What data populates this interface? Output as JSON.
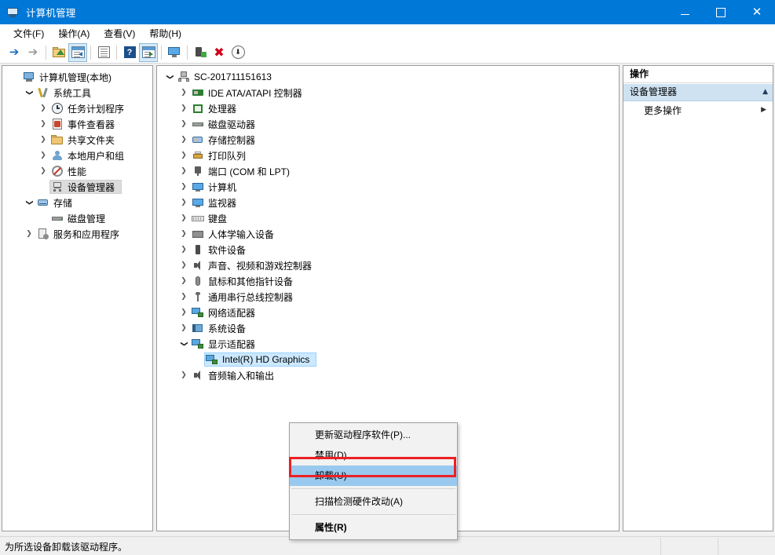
{
  "window": {
    "title": "计算机管理",
    "icon": "computer-management-icon",
    "minimize_label": "最小化",
    "maximize_label": "最大化",
    "close_label": "关闭",
    "titlebar_color": "#0078d7"
  },
  "menubar": {
    "items": [
      {
        "label": "文件(F)",
        "name": "menu-file"
      },
      {
        "label": "操作(A)",
        "name": "menu-action"
      },
      {
        "label": "查看(V)",
        "name": "menu-view"
      },
      {
        "label": "帮助(H)",
        "name": "menu-help"
      }
    ]
  },
  "toolbar": {
    "buttons": [
      {
        "name": "back-button",
        "icon": "back-arrow-icon",
        "glyph": "←",
        "enabled": true
      },
      {
        "name": "forward-button",
        "icon": "forward-arrow-icon",
        "glyph": "→",
        "enabled": false
      },
      {
        "name": "up-one-level-button",
        "icon": "folder-up-icon"
      },
      {
        "name": "show-hide-tree-button",
        "icon": "console-tree-icon",
        "pressed": true
      },
      {
        "name": "properties-button",
        "icon": "properties-icon"
      },
      {
        "name": "help-button",
        "icon": "help-icon",
        "glyph": "?"
      },
      {
        "name": "show-action-pane-button",
        "icon": "action-pane-icon",
        "pressed": true
      },
      {
        "name": "monitor-button",
        "icon": "monitor-icon"
      },
      {
        "name": "update-driver-button",
        "icon": "update-driver-icon"
      },
      {
        "name": "uninstall-button",
        "icon": "red-x-icon",
        "glyph": "✖"
      },
      {
        "name": "scan-hardware-button",
        "icon": "scan-hardware-icon",
        "glyph": "↓"
      }
    ]
  },
  "console_tree": {
    "items": [
      {
        "label": "计算机管理(本地)",
        "indent": 0,
        "chevron": "none",
        "icon": "computer-management-icon",
        "selected": false
      },
      {
        "label": "系统工具",
        "indent": 1,
        "chevron": "open",
        "icon": "system-tools-icon",
        "selected": false
      },
      {
        "label": "任务计划程序",
        "indent": 2,
        "chevron": "closed",
        "icon": "task-scheduler-icon",
        "selected": false
      },
      {
        "label": "事件查看器",
        "indent": 2,
        "chevron": "closed",
        "icon": "event-viewer-icon",
        "selected": false
      },
      {
        "label": "共享文件夹",
        "indent": 2,
        "chevron": "closed",
        "icon": "shared-folders-icon",
        "selected": false
      },
      {
        "label": "本地用户和组",
        "indent": 2,
        "chevron": "closed",
        "icon": "local-users-icon",
        "selected": false
      },
      {
        "label": "性能",
        "indent": 2,
        "chevron": "closed",
        "icon": "performance-icon",
        "selected": false
      },
      {
        "label": "设备管理器",
        "indent": 2,
        "chevron": "none",
        "icon": "device-manager-icon",
        "selected": true
      },
      {
        "label": "存储",
        "indent": 1,
        "chevron": "open",
        "icon": "storage-icon",
        "selected": false
      },
      {
        "label": "磁盘管理",
        "indent": 2,
        "chevron": "none",
        "icon": "disk-management-icon",
        "selected": false
      },
      {
        "label": "服务和应用程序",
        "indent": 1,
        "chevron": "closed",
        "icon": "services-apps-icon",
        "selected": false
      }
    ]
  },
  "device_tree": {
    "items": [
      {
        "label": "SC-201711151613",
        "indent": 0,
        "chevron": "open",
        "icon": "computer-root-icon",
        "selected": false
      },
      {
        "label": "IDE ATA/ATAPI 控制器",
        "indent": 1,
        "chevron": "closed",
        "icon": "ide-controller-icon",
        "selected": false
      },
      {
        "label": "处理器",
        "indent": 1,
        "chevron": "closed",
        "icon": "processor-icon",
        "selected": false
      },
      {
        "label": "磁盘驱动器",
        "indent": 1,
        "chevron": "closed",
        "icon": "disk-drive-icon",
        "selected": false
      },
      {
        "label": "存储控制器",
        "indent": 1,
        "chevron": "closed",
        "icon": "storage-controller-icon",
        "selected": false
      },
      {
        "label": "打印队列",
        "indent": 1,
        "chevron": "closed",
        "icon": "print-queue-icon",
        "selected": false
      },
      {
        "label": "端口 (COM 和 LPT)",
        "indent": 1,
        "chevron": "closed",
        "icon": "ports-icon",
        "selected": false
      },
      {
        "label": "计算机",
        "indent": 1,
        "chevron": "closed",
        "icon": "computer-icon",
        "selected": false
      },
      {
        "label": "监视器",
        "indent": 1,
        "chevron": "closed",
        "icon": "monitor-icon",
        "selected": false
      },
      {
        "label": "键盘",
        "indent": 1,
        "chevron": "closed",
        "icon": "keyboard-icon",
        "selected": false
      },
      {
        "label": "人体学输入设备",
        "indent": 1,
        "chevron": "closed",
        "icon": "hid-icon",
        "selected": false
      },
      {
        "label": "软件设备",
        "indent": 1,
        "chevron": "closed",
        "icon": "software-device-icon",
        "selected": false
      },
      {
        "label": "声音、视频和游戏控制器",
        "indent": 1,
        "chevron": "closed",
        "icon": "sound-video-icon",
        "selected": false
      },
      {
        "label": "鼠标和其他指针设备",
        "indent": 1,
        "chevron": "closed",
        "icon": "mouse-icon",
        "selected": false
      },
      {
        "label": "通用串行总线控制器",
        "indent": 1,
        "chevron": "closed",
        "icon": "usb-controller-icon",
        "selected": false
      },
      {
        "label": "网络适配器",
        "indent": 1,
        "chevron": "closed",
        "icon": "network-adapter-icon",
        "selected": false
      },
      {
        "label": "系统设备",
        "indent": 1,
        "chevron": "closed",
        "icon": "system-device-icon",
        "selected": false
      },
      {
        "label": "显示适配器",
        "indent": 1,
        "chevron": "open",
        "icon": "display-adapter-icon",
        "selected": false
      },
      {
        "label": "Intel(R) HD Graphics",
        "indent": 2,
        "chevron": "none",
        "icon": "display-adapter-icon",
        "selected": true
      },
      {
        "label": "音频输入和输出",
        "indent": 1,
        "chevron": "closed",
        "icon": "audio-io-icon",
        "selected": false
      }
    ]
  },
  "actions_pane": {
    "title": "操作",
    "section": {
      "label": "设备管理器",
      "collapse_icon": "chevron-up-icon"
    },
    "rows": [
      {
        "label": "更多操作",
        "submenu_icon": "chevron-right-icon"
      }
    ]
  },
  "context_menu": {
    "items": [
      {
        "label": "更新驱动程序软件(P)...",
        "highlighted": false,
        "bold": false,
        "separator_after": false
      },
      {
        "label": "禁用(D)",
        "highlighted": false,
        "bold": false,
        "separator_after": false
      },
      {
        "label": "卸载(U)",
        "highlighted": true,
        "bold": false,
        "separator_after": true
      },
      {
        "label": "扫描检测硬件改动(A)",
        "highlighted": false,
        "bold": false,
        "separator_after": true
      },
      {
        "label": "属性(R)",
        "highlighted": false,
        "bold": true,
        "separator_after": false
      }
    ],
    "highlight_color": "#99c9ee",
    "annotation_color": "#ec2024"
  },
  "statusbar": {
    "message": "为所选设备卸载该驱动程序。"
  }
}
